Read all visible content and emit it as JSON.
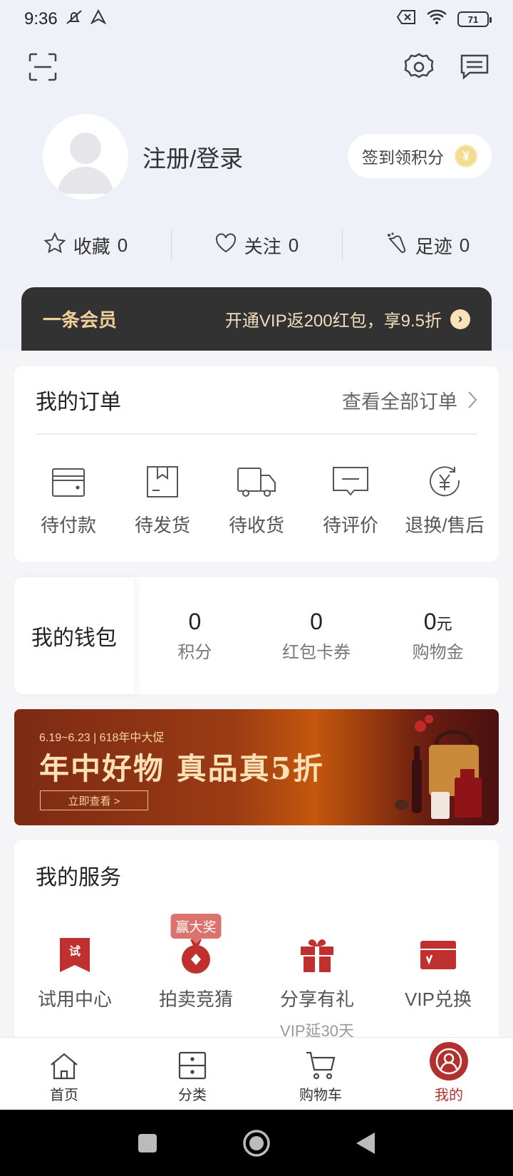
{
  "status_bar": {
    "time": "9:36",
    "battery": "71"
  },
  "profile": {
    "login_label": "注册/登录",
    "checkin_label": "签到领积分",
    "coin_symbol": "¥"
  },
  "stats": [
    {
      "label": "收藏",
      "count": "0",
      "icon": "star-icon"
    },
    {
      "label": "关注",
      "count": "0",
      "icon": "heart-icon"
    },
    {
      "label": "足迹",
      "count": "0",
      "icon": "footprint-icon"
    }
  ],
  "vip": {
    "title": "一条会员",
    "promo": "开通VIP返200红包，享9.5折",
    "arrow": "›"
  },
  "orders": {
    "title": "我的订单",
    "view_all": "查看全部订单",
    "items": [
      {
        "label": "待付款",
        "icon": "wallet-icon"
      },
      {
        "label": "待发货",
        "icon": "package-icon"
      },
      {
        "label": "待收货",
        "icon": "truck-icon"
      },
      {
        "label": "待评价",
        "icon": "comment-icon"
      },
      {
        "label": "退换/售后",
        "icon": "refund-icon"
      }
    ]
  },
  "wallet": {
    "title": "我的钱包",
    "items": [
      {
        "value": "0",
        "unit": "",
        "label": "积分"
      },
      {
        "value": "0",
        "unit": "",
        "label": "红包卡券"
      },
      {
        "value": "0",
        "unit": "元",
        "label": "购物金"
      }
    ]
  },
  "banner": {
    "subtitle": "6.19~6.23 | 618年中大促",
    "title": "年中好物 真品真5折",
    "button": "立即查看 >"
  },
  "services": {
    "title": "我的服务",
    "items": [
      {
        "label": "试用中心",
        "icon": "trial-icon",
        "badge": "",
        "sub": ""
      },
      {
        "label": "拍卖竞猜",
        "icon": "auction-icon",
        "badge": "赢大奖",
        "sub": ""
      },
      {
        "label": "分享有礼",
        "icon": "gift-icon",
        "badge": "",
        "sub": "VIP延30天"
      },
      {
        "label": "VIP兑换",
        "icon": "vip-card-icon",
        "badge": "",
        "sub": ""
      }
    ]
  },
  "tabs": [
    {
      "label": "首页",
      "icon": "home-icon",
      "active": false
    },
    {
      "label": "分类",
      "icon": "category-icon",
      "active": false
    },
    {
      "label": "购物车",
      "icon": "cart-icon",
      "active": false
    },
    {
      "label": "我的",
      "icon": "user-icon",
      "active": true
    }
  ],
  "colors": {
    "accent": "#b2302e",
    "vip_gold": "#f1cf9a",
    "header_bg": "#eff1f8"
  }
}
